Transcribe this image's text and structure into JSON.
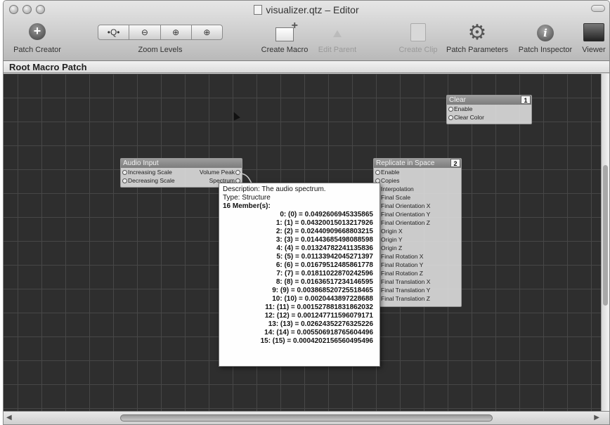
{
  "window": {
    "title": "visualizer.qtz – Editor"
  },
  "toolbar": {
    "patch_creator": "Patch Creator",
    "zoom_levels": "Zoom Levels",
    "zoom_buttons": [
      "•Q•",
      "⊖",
      "⊕",
      "⊕"
    ],
    "create_macro": "Create Macro",
    "edit_parent": "Edit Parent",
    "create_clip": "Create Clip",
    "patch_parameters": "Patch Parameters",
    "patch_inspector": "Patch Inspector",
    "viewer": "Viewer"
  },
  "breadcrumb": "Root Macro Patch",
  "patches": {
    "clear": {
      "title": "Clear",
      "badge": "1",
      "inputs": [
        "Enable",
        "Clear Color"
      ]
    },
    "audio_input": {
      "title": "Audio Input",
      "inputs": [
        "Increasing Scale",
        "Decreasing Scale"
      ],
      "outputs": [
        "Volume Peak",
        "Spectrum"
      ]
    },
    "replicate": {
      "title": "Replicate in Space",
      "badge": "2",
      "inputs": [
        "Enable",
        "Copies",
        "Interpolation",
        "Final Scale",
        "Final Orientation X",
        "Final Orientation Y",
        "Final Orientation Z",
        "Origin X",
        "Origin Y",
        "Origin Z",
        "Final Rotation X",
        "Final Rotation Y",
        "Final Rotation Z",
        "Final Translation X",
        "Final Translation Y",
        "Final Translation Z"
      ]
    }
  },
  "tooltip": {
    "description": "Description: The audio spectrum.",
    "type": "Type: Structure",
    "members_header": "16 Member(s):",
    "members": [
      "0: (0) = 0.0492606945335865",
      "1: (1) = 0.04320015013217926",
      "2: (2) = 0.02440909668803215",
      "3: (3) = 0.01443685498088598",
      "4: (4) = 0.01324782241135836",
      "5: (5) = 0.01133942045271397",
      "6: (6) = 0.01679512485861778",
      "7: (7) = 0.01811022870242596",
      "8: (8) = 0.01636517234146595",
      "9: (9) = 0.003868520725518465",
      "10: (10) = 0.002044389722868​8",
      "11: (11) = 0.001527881831862032",
      "12: (12) = 0.001247711596079171",
      "13: (13) = 0.02624352276325226",
      "14: (14) = 0.005506918765604496",
      "15: (15) = 0.0004202156560495496"
    ]
  }
}
